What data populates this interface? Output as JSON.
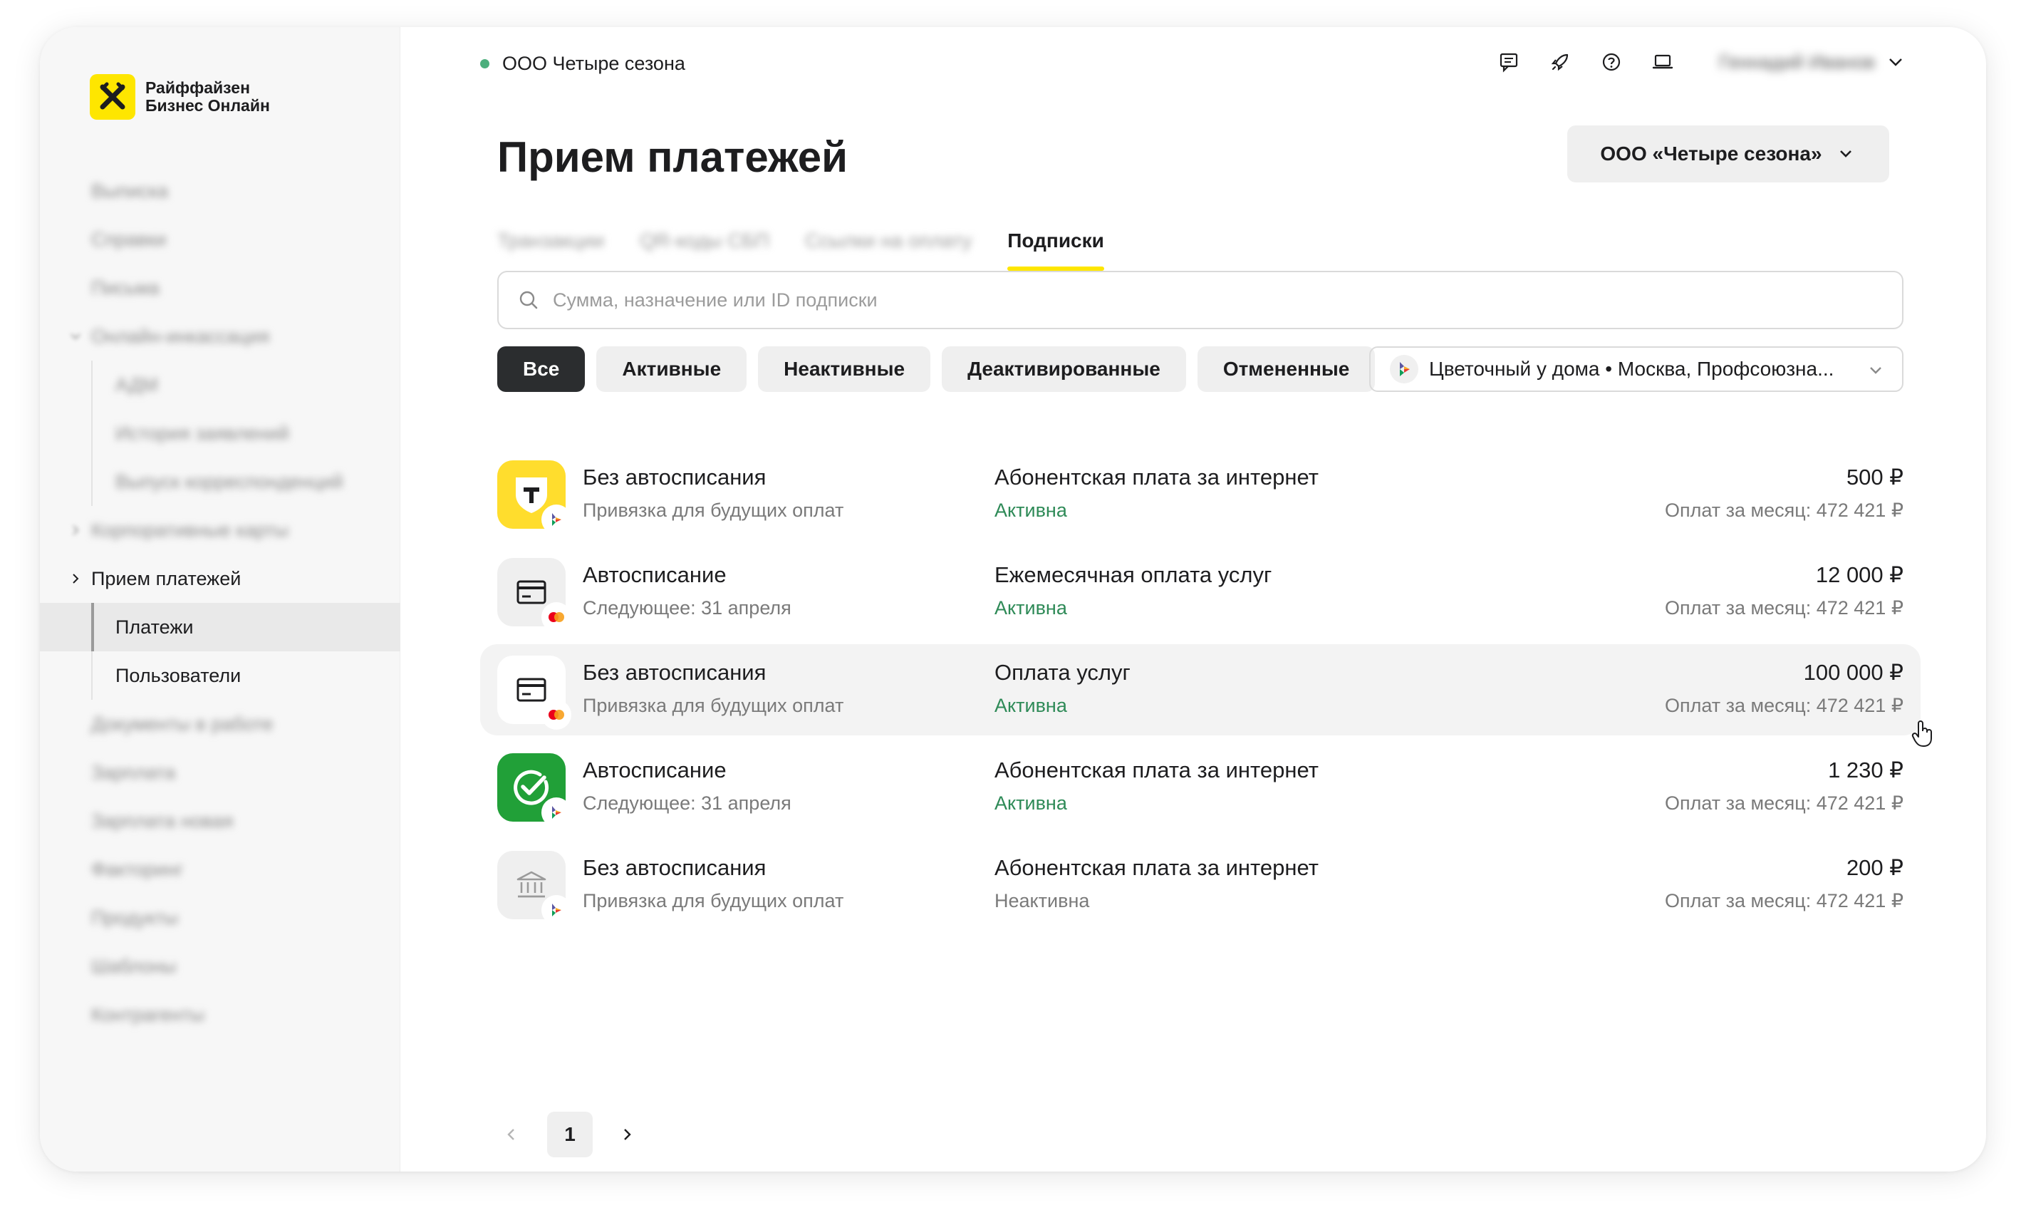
{
  "brand": {
    "name_line1": "Райффайзен",
    "name_line2": "Бизнес Онлайн",
    "accent": "#fee600"
  },
  "sidebar": {
    "items": [
      {
        "label": "Выписка",
        "blurred": true
      },
      {
        "label": "Справки",
        "blurred": true
      },
      {
        "label": "Письма",
        "blurred": true
      },
      {
        "label": "Онлайн-инкассация",
        "blurred": true
      },
      {
        "label": "АДМ",
        "blurred": true
      },
      {
        "label": "История заявлений",
        "blurred": true
      },
      {
        "label": "Выпуск корреспонденций",
        "blurred": true
      },
      {
        "label": "Корпоративные карты",
        "blurred": true
      },
      {
        "label": "Прием платежей",
        "blurred": false
      },
      {
        "label": "Платежи",
        "blurred": false
      },
      {
        "label": "Пользователи",
        "blurred": false
      },
      {
        "label": "Документы в работе",
        "blurred": true
      },
      {
        "label": "Зарплата",
        "blurred": true
      },
      {
        "label": "Зарплата новая",
        "blurred": true
      },
      {
        "label": "Факторинг",
        "blurred": true
      },
      {
        "label": "Продукты",
        "blurred": true
      },
      {
        "label": "Шаблоны",
        "blurred": true
      },
      {
        "label": "Контрагенты",
        "blurred": true
      }
    ]
  },
  "topbar": {
    "company": "ООО Четыре сезона",
    "user_name": "Геннадий Иванов",
    "icons": [
      "chat-icon",
      "rocket-icon",
      "help-icon",
      "laptop-icon"
    ]
  },
  "page": {
    "title": "Прием платежей",
    "company_select": "ООО «Четыре сезона»",
    "tabs": [
      {
        "label": "Транзакции",
        "blurred": true
      },
      {
        "label": "QR-коды СБП",
        "blurred": true
      },
      {
        "label": "Ссылки на оплату",
        "blurred": true
      },
      {
        "label": "Подписки",
        "active": true
      }
    ],
    "search_placeholder": "Сумма, назначение или ID подписки",
    "filters": [
      "Все",
      "Активные",
      "Неактивные",
      "Деактивированные",
      "Отмененные"
    ],
    "active_filter": "Все",
    "store_select": {
      "name": "Цветочный у дома",
      "address": "Москва, Профсоюзна..."
    }
  },
  "subscriptions": [
    {
      "type": "Без автосписания",
      "sub": "Привязка для будущих оплат",
      "purpose": "Абонентская плата за интернет",
      "status": "Активна",
      "amount": "500 ₽",
      "monthly": "Оплат за месяц: 472 421 ₽",
      "bank": "tbank-icon"
    },
    {
      "type": "Автосписание",
      "sub": "Следующее: 31 апреля",
      "purpose": "Ежемесячная оплата услуг",
      "status": "Активна",
      "amount": "12 000 ₽",
      "monthly": "Оплат за месяц: 472 421 ₽",
      "bank": "card-icon"
    },
    {
      "type": "Без автосписания",
      "sub": "Привязка для будущих оплат",
      "purpose": "Оплата услуг",
      "status": "Активна",
      "amount": "100 000 ₽",
      "monthly": "Оплат за месяц: 472 421 ₽",
      "bank": "card-icon"
    },
    {
      "type": "Автосписание",
      "sub": "Следующее: 31 апреля",
      "purpose": "Абонентская плата за интернет",
      "status": "Активна",
      "amount": "1 230 ₽",
      "monthly": "Оплат за месяц: 472 421 ₽",
      "bank": "sber-icon"
    },
    {
      "type": "Без автосписания",
      "sub": "Привязка для будущих оплат",
      "purpose": "Абонентская плата за интернет",
      "status": "Неактивна",
      "amount": "200 ₽",
      "monthly": "Оплат за месяц: 472 421 ₽",
      "bank": "bank-building-icon"
    }
  ],
  "pagination": {
    "current_page": "1"
  },
  "colors": {
    "active_status": "#2e8a57",
    "dark_chip": "#2b2d2f",
    "chip_bg": "#efefef"
  }
}
